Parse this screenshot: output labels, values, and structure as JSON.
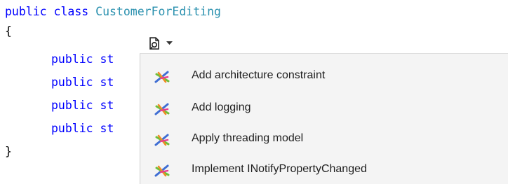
{
  "code": {
    "line1": {
      "kw": "public class ",
      "type": "CustomerForEditing"
    },
    "open_brace": "{",
    "member_fragment": "public st",
    "close_brace": "}"
  },
  "smart_tag": {
    "icon": "refactor-lightbulb-icon",
    "caret_icon": "chevron-down-icon"
  },
  "menu": {
    "items": [
      {
        "label": "Add architecture constraint",
        "icon": "aspect-tool-icon"
      },
      {
        "label": "Add logging",
        "icon": "aspect-tool-icon"
      },
      {
        "label": "Apply threading model",
        "icon": "aspect-tool-icon"
      },
      {
        "label": "Implement INotifyPropertyChanged",
        "icon": "aspect-tool-icon"
      }
    ]
  },
  "colors": {
    "keyword": "#0000ff",
    "type_name": "#2b91af",
    "menu_background": "#f4f4f4",
    "icon_blue": "#3f6ed3",
    "icon_green": "#6fbf3a",
    "icon_orange": "#f08a24",
    "icon_pink": "#e83a8f"
  }
}
